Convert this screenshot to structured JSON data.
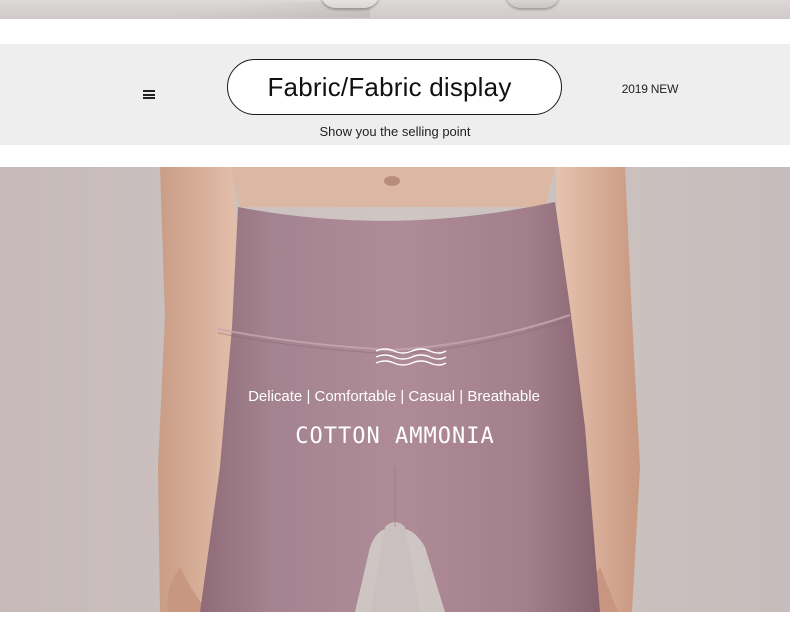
{
  "header": {
    "title": "Fabric/Fabric display",
    "subtitle": "Show you the selling point",
    "badge": "2019 NEW",
    "menu_icon": "menu-icon"
  },
  "product_banner": {
    "features": "Delicate | Comfortable | Casual | Breathable",
    "material": "COTTON AMMONIA",
    "wave_icon": "wave-icon",
    "colors": {
      "fabric": "#a7828d",
      "background": "#c8bebd",
      "skin": "#d8b29c"
    }
  }
}
